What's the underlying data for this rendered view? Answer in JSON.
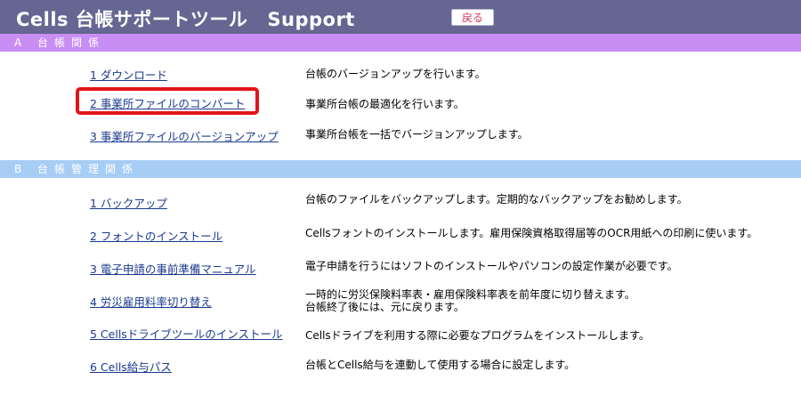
{
  "header": {
    "title_en": "Cells",
    "title_jp": "台帳サポートツール",
    "title_suffix": "Support",
    "back_label": "戻る"
  },
  "colors": {
    "titlebar": "#656691",
    "section_a": "#c88ef4",
    "section_b": "#a7cdf5",
    "link": "#1a3a8e",
    "highlight": "#e3141a"
  },
  "section_a": {
    "title": "A 台帳関係",
    "items": [
      {
        "label": "1 ダウンロード",
        "desc": "台帳のバージョンアップを行います。"
      },
      {
        "label": "2 事業所ファイルのコンバート",
        "desc": "事業所台帳の最適化を行います。"
      },
      {
        "label": "3 事業所ファイルのバージョンアップ",
        "desc": "事業所台帳を一括でバージョンアップします。"
      }
    ]
  },
  "section_b": {
    "title": "B 台帳管理関係",
    "items": [
      {
        "label": "1 バックアップ",
        "desc": "台帳のファイルをバックアップします。定期的なバックアップをお勧めします。"
      },
      {
        "label": "2 フォントのインストール",
        "desc": "Cellsフォントのインストールします。雇用保険資格取得届等のOCR用紙への印刷に使います。"
      },
      {
        "label": "3 電子申請の事前準備マニュアル",
        "desc": "電子申請を行うにはソフトのインストールやパソコンの設定作業が必要です。"
      },
      {
        "label": "4 労災雇用料率切り替え",
        "desc": "一時的に労災保険料率表・雇用保険料率表を前年度に切り替えます。",
        "desc2": "台帳終了後には、元に戻ります。"
      },
      {
        "label": "5 Cellsドライブツールのインストール",
        "desc": "Cellsドライブを利用する際に必要なプログラムをインストールします。"
      },
      {
        "label": "6 Cells給与パス",
        "desc": "台帳とCells給与を連動して使用する場合に設定します。"
      }
    ]
  }
}
